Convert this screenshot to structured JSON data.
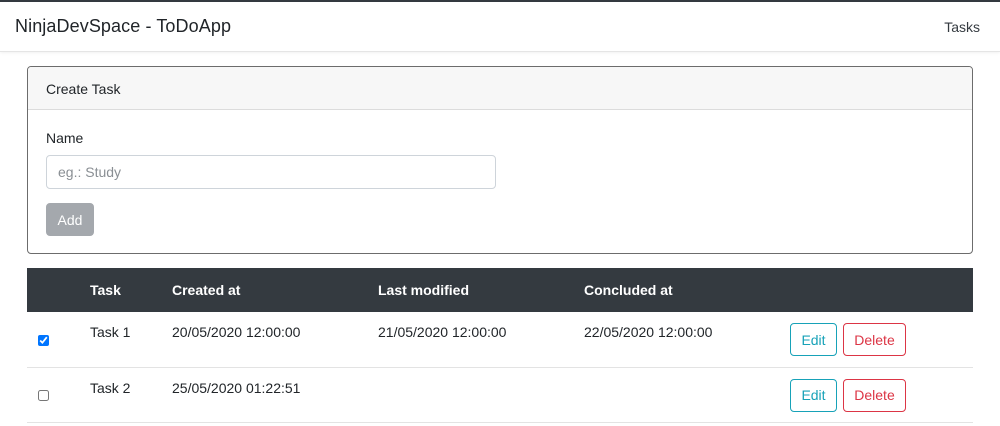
{
  "navbar": {
    "brand": "NinjaDevSpace - ToDoApp",
    "tasks_link": "Tasks"
  },
  "create_task": {
    "header": "Create Task",
    "name_label": "Name",
    "name_placeholder": "eg.: Study",
    "name_value": "",
    "add_label": "Add"
  },
  "table": {
    "headers": [
      "",
      "Task",
      "Created at",
      "Last modified",
      "Concluded at",
      ""
    ],
    "rows": [
      {
        "checked": true,
        "task": "Task 1",
        "created_at": "20/05/2020 12:00:00",
        "last_modified": "21/05/2020 12:00:00",
        "concluded_at": "22/05/2020 12:00:00",
        "edit_label": "Edit",
        "delete_label": "Delete"
      },
      {
        "checked": false,
        "task": "Task 2",
        "created_at": "25/05/2020 01:22:51",
        "last_modified": "",
        "concluded_at": "",
        "edit_label": "Edit",
        "delete_label": "Delete"
      }
    ]
  },
  "colors": {
    "dark": "#343a40",
    "info": "#17a2b8",
    "danger": "#dc3545",
    "secondary_disabled": "#a4a8ad"
  }
}
